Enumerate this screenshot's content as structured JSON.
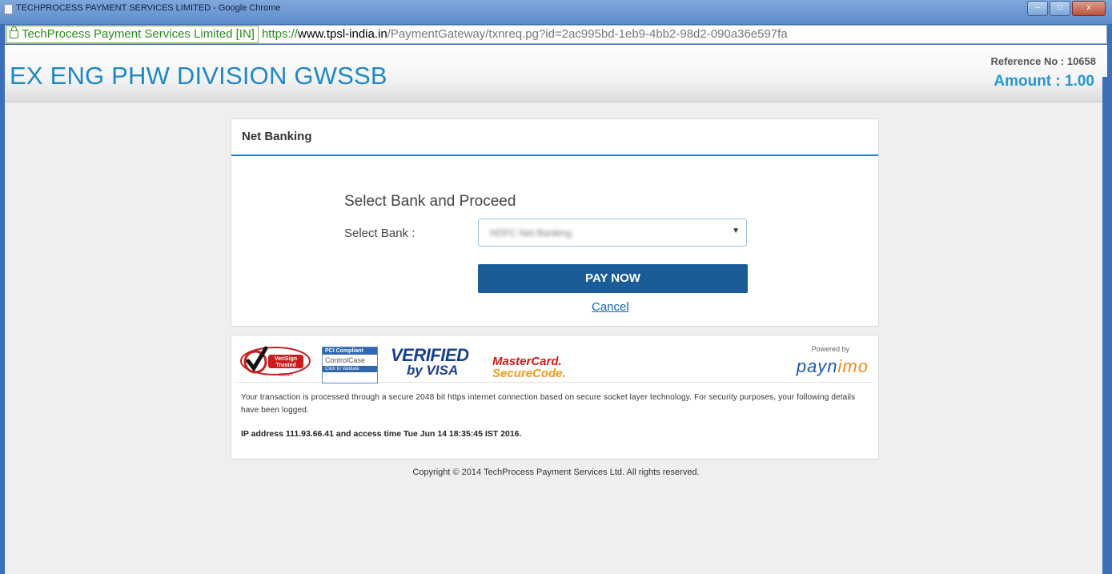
{
  "window": {
    "title": "TECHPROCESS PAYMENT SERVICES LIMITED - Google Chrome",
    "controls": [
      "–",
      "□",
      "x"
    ]
  },
  "address_bar": {
    "ev_label": "TechProcess Payment Services Limited [IN]",
    "scheme": "https://",
    "host": "www.tpsl-india.in",
    "path": "/PaymentGateway/txnreq.pg?id=2ac995bd-1eb9-4bb2-98d2-090a36e597fa"
  },
  "header": {
    "merchant_name": "EX ENG PHW DIVISION GWSSB",
    "reference": "Reference No : 10658",
    "amount": "Amount : 1.00"
  },
  "net_banking": {
    "card_title": "Net Banking",
    "section_title": "Select Bank and Proceed",
    "bank_label": "Select Bank :",
    "selected_bank": "HDFC Net Banking",
    "pay_button": "PAY NOW",
    "cancel_link": "Cancel"
  },
  "trust_badges": {
    "verisign": [
      "VeriSign",
      "Trusted",
      "VERIFY"
    ],
    "pci": [
      "PCI Compliant",
      "ControlCase",
      "Click to Validate"
    ],
    "verified_by_visa": [
      "VERIFIED",
      "by VISA"
    ],
    "mastercard": [
      "MasterCard.",
      "SecureCode."
    ],
    "powered_by": "Powered by",
    "paynimo": [
      "payn",
      "imo"
    ]
  },
  "security_notice": "Your transaction is processed through a secure 2048 bit https internet connection based on secure socket layer technology. For security purposes, your following details have been logged.",
  "ip_line": "IP address 111.93.66.41 and access time Tue Jun 14 18:35:45 IST 2016.",
  "footer": {
    "copyright": "Copyright © 2014 TechProcess Payment Services Ltd. All rights reserved."
  },
  "colors": {
    "brand_blue": "#1e88c7",
    "button_blue": "#195c98",
    "link_blue": "#1565b4"
  }
}
